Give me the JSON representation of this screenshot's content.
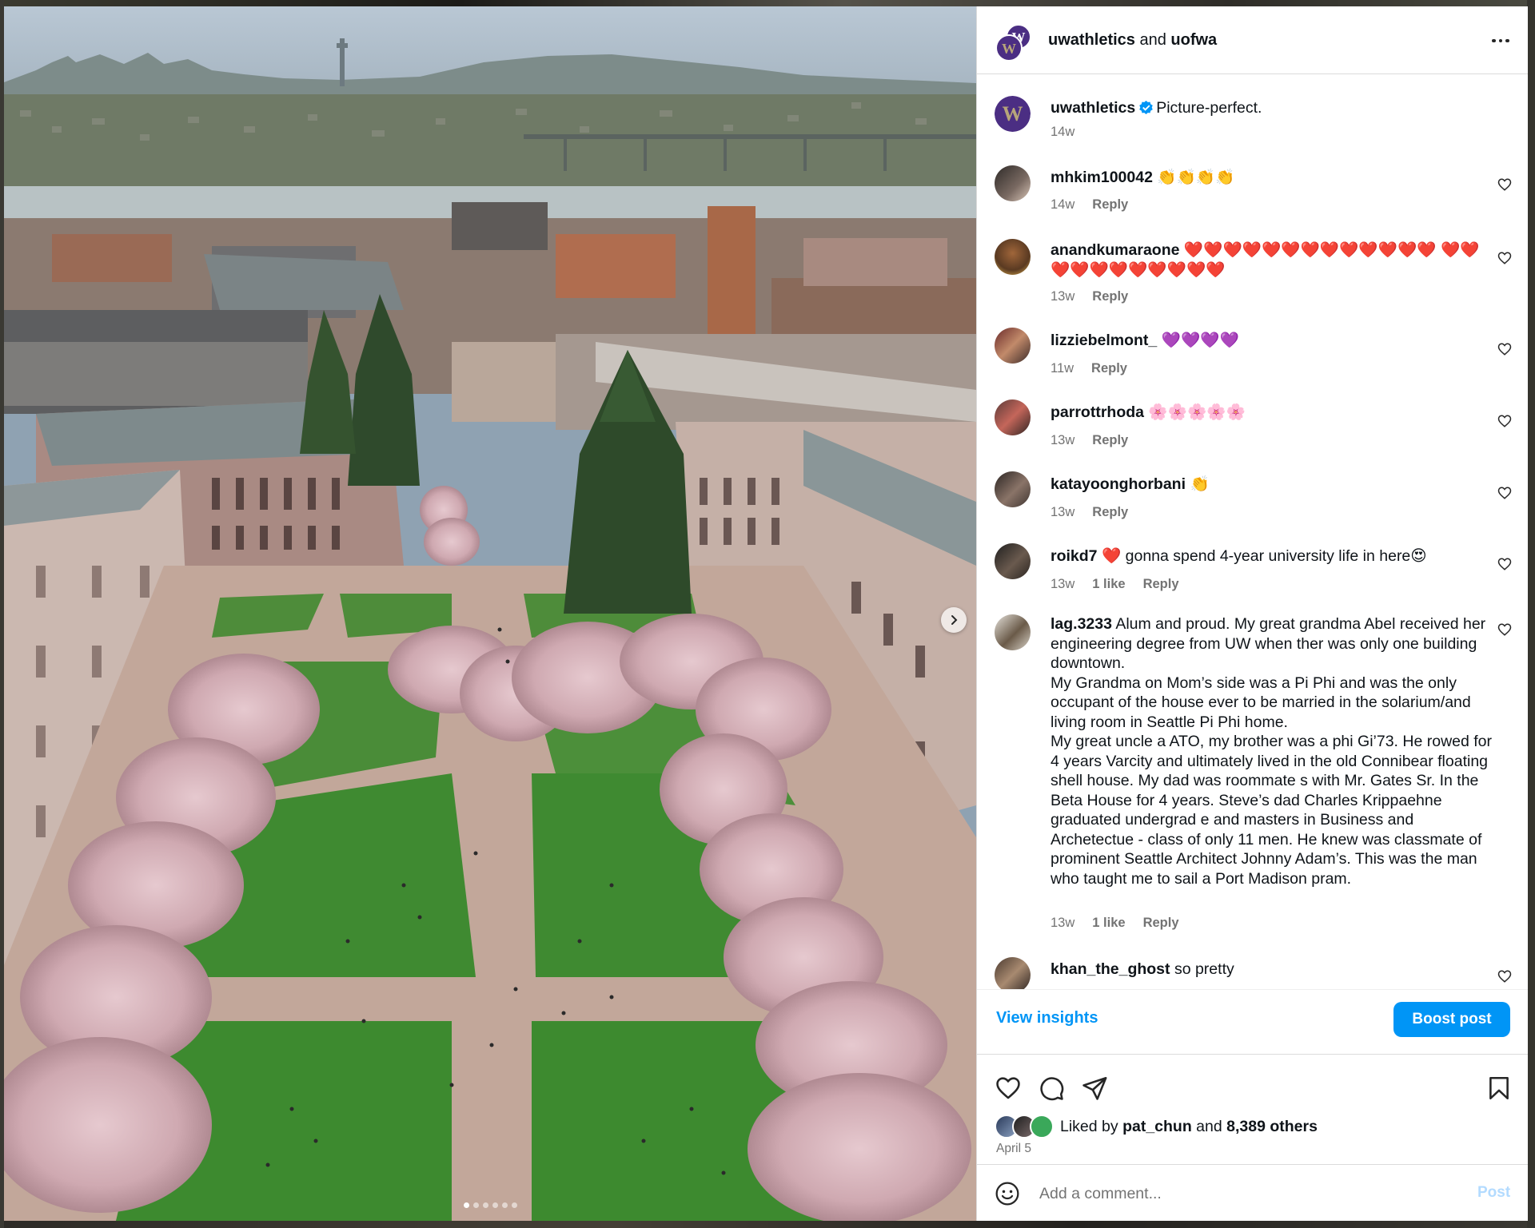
{
  "header": {
    "account": "uwathletics",
    "joiner": " and ",
    "collaborator": "uofwa",
    "avatar_letter": "W"
  },
  "caption": {
    "username": "uwathletics",
    "text": "Picture-perfect.",
    "time": "14w",
    "avatar_letter": "W"
  },
  "comments": [
    {
      "username": "mhkim100042",
      "text": "👏👏👏👏",
      "time": "14w",
      "likes": "",
      "reply": "Reply"
    },
    {
      "username": "anandkumaraone",
      "text": "❤️❤️❤️❤️❤️❤️❤️❤️❤️❤️❤️❤️❤️ ❤️❤️❤️❤️❤️❤️❤️❤️❤️❤️❤️",
      "time": "13w",
      "likes": "",
      "reply": "Reply"
    },
    {
      "username": "lizziebelmont_",
      "text": "💜💜💜💜",
      "time": "11w",
      "likes": "",
      "reply": "Reply"
    },
    {
      "username": "parrottrhoda",
      "text": "🌸🌸🌸🌸🌸",
      "time": "13w",
      "likes": "",
      "reply": "Reply"
    },
    {
      "username": "katayoonghorbani",
      "text": "👏",
      "time": "13w",
      "likes": "",
      "reply": "Reply"
    },
    {
      "username": "roikd7",
      "text": "❤️ gonna spend 4-year university life in here😍",
      "time": "13w",
      "likes": "1 like",
      "reply": "Reply"
    },
    {
      "username": "lag.3233",
      "text": "Alum and proud. My great grandma Abel received her engineering degree from UW when ther was only one building downtown.\nMy Grandma on Mom’s side was a Pi Phi and was the only occupant of the house ever to be married in the solarium/and living room in Seattle Pi Phi home.\nMy great uncle a ATO, my brother was a phi Gi’73. He rowed for 4 years Varcity and ultimately lived in the old Connibear floating shell house. My dad was roommate s with Mr. Gates Sr. In the Beta House for 4 years. Steve’s dad Charles Krippaehne graduated undergrad e and masters in Business and Archetectue - class of only 11 men. He knew was classmate of prominent Seattle Architect Johnny Adam’s. This was the man who taught me to sail a Port Madison pram.",
      "time": "13w",
      "likes": "1 like",
      "reply": "Reply"
    },
    {
      "username": "khan_the_ghost",
      "text": "so pretty",
      "time": "",
      "likes": "",
      "reply": ""
    }
  ],
  "insights": {
    "label": "View insights"
  },
  "boost": {
    "label": "Boost post"
  },
  "likes": {
    "prefix": "Liked by ",
    "user": "pat_chun",
    "middle": " and ",
    "count": "8,389 others"
  },
  "date": "April 5",
  "add_comment": {
    "placeholder": "Add a comment...",
    "post_label": "Post"
  },
  "carousel": {
    "slides": 6,
    "active": 1
  },
  "colors": {
    "accent": "#0095f6",
    "uw_purple": "#4b2e83",
    "uw_gold": "#b7a57a"
  },
  "icons": [
    "more-icon",
    "verified-icon",
    "heart-icon",
    "comment-icon",
    "share-icon",
    "save-icon",
    "emoji-icon",
    "chevron-right-icon"
  ]
}
